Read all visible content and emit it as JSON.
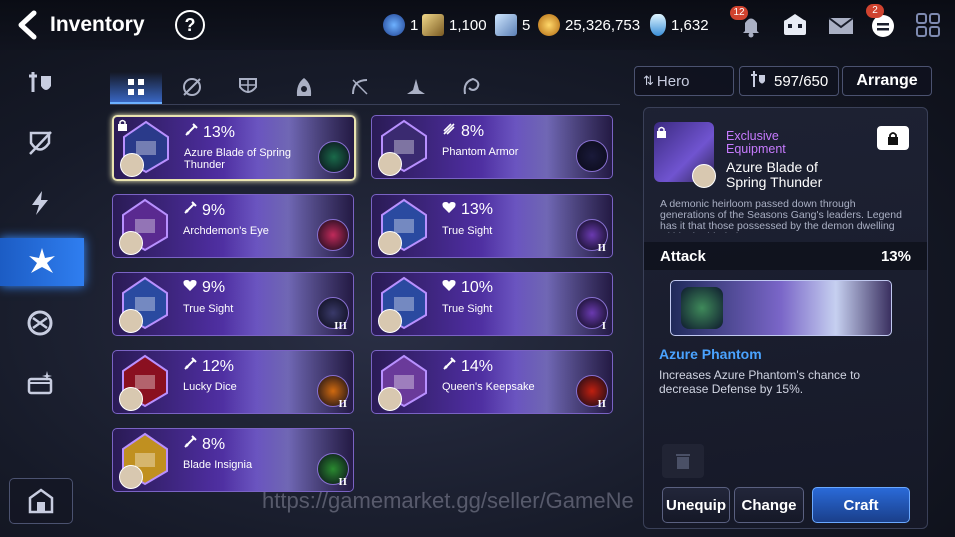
{
  "header": {
    "title": "Inventory",
    "help_glyph": "?"
  },
  "resources": [
    {
      "icon": "stigma-icon",
      "value": "1"
    },
    {
      "icon": "leifs-icon",
      "value": "1,100"
    },
    {
      "icon": "mystic-medal-icon",
      "value": "5"
    },
    {
      "icon": "gold-icon",
      "value": "25,326,753"
    },
    {
      "icon": "skystone-icon",
      "value": "1,632"
    }
  ],
  "top_badges": {
    "bell": "12",
    "chat": "2"
  },
  "controls": {
    "sort_label": "Hero",
    "capacity": "597/650",
    "arrange_label": "Arrange"
  },
  "items": [
    {
      "stat": "13%",
      "stat_icon": "attack-icon",
      "name": "Azure Blade of Spring Thunder",
      "rank": ""
    },
    {
      "stat": "8%",
      "stat_icon": "crit-icon",
      "name": "Phantom Armor",
      "rank": ""
    },
    {
      "stat": "9%",
      "stat_icon": "attack-icon",
      "name": "Archdemon's Eye",
      "rank": ""
    },
    {
      "stat": "13%",
      "stat_icon": "health-icon",
      "name": "True Sight",
      "rank": "II"
    },
    {
      "stat": "9%",
      "stat_icon": "health-icon",
      "name": "True Sight",
      "rank": "III"
    },
    {
      "stat": "10%",
      "stat_icon": "health-icon",
      "name": "True Sight",
      "rank": "I"
    },
    {
      "stat": "12%",
      "stat_icon": "attack-icon",
      "name": "Lucky Dice",
      "rank": "II"
    },
    {
      "stat": "14%",
      "stat_icon": "attack-icon",
      "name": "Queen's Keepsake",
      "rank": "II"
    },
    {
      "stat": "8%",
      "stat_icon": "attack-icon",
      "name": "Blade Insignia",
      "rank": "II"
    }
  ],
  "detail": {
    "type_label": "Exclusive Equipment",
    "name": "Azure Blade of Spring Thunder",
    "description": "A demonic heirloom passed down through generations of the Seasons Gang's leaders. Legend has it that those possessed by the demon dwelling within the blade become a curse.",
    "stat_label": "Attack",
    "stat_value": "13%",
    "hero_name": "Azure Phantom",
    "effect": "Increases Azure Phantom's chance to decrease Defense by 15%."
  },
  "buttons": {
    "unequip": "Unequip",
    "change": "Change",
    "craft": "Craft"
  },
  "watermark": "https://gamemarket.gg/seller/GameNe",
  "colors": {
    "accent": "#2f7ef0",
    "exclusive": "#c77bff",
    "hero_name": "#4aa3ff"
  }
}
